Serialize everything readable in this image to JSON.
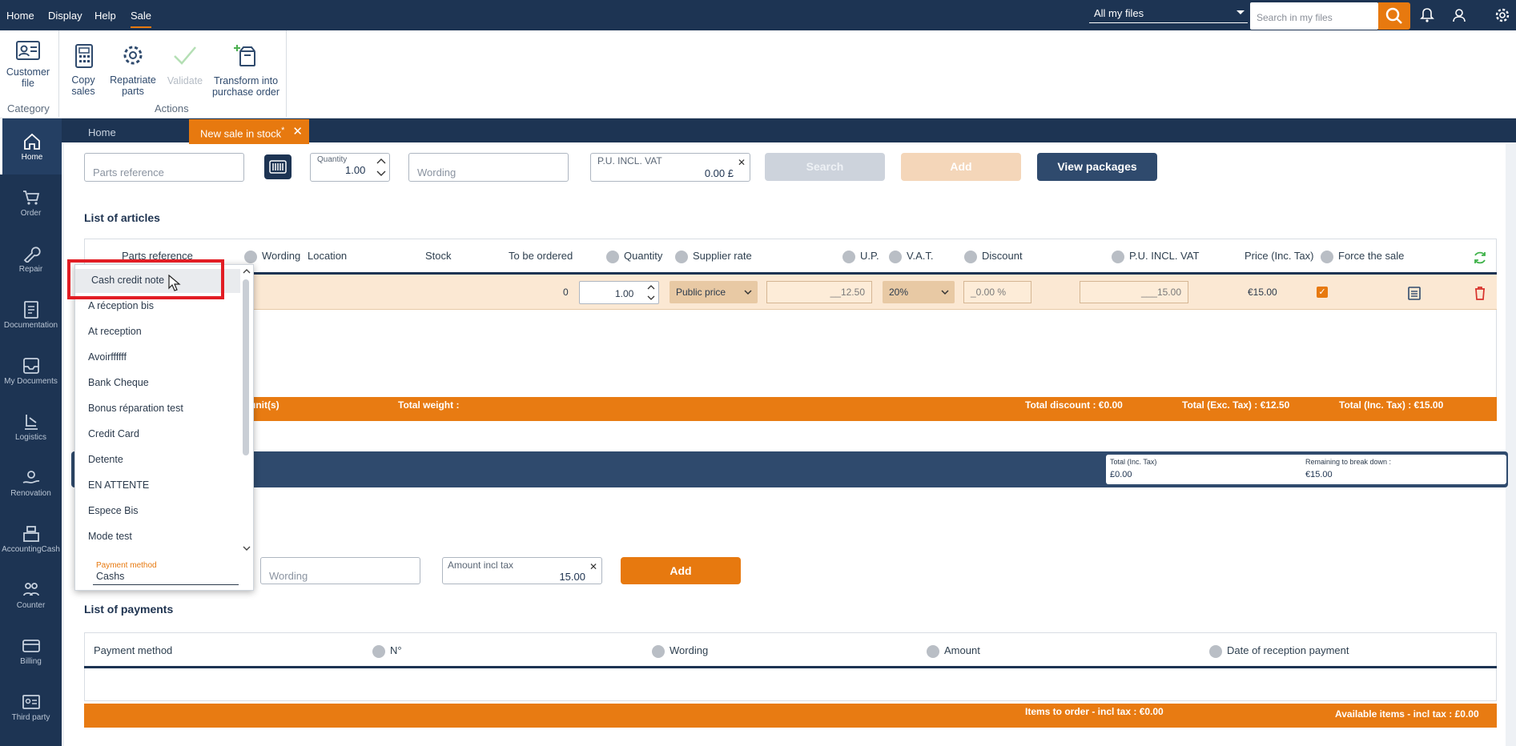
{
  "topbar": {
    "menu": [
      "Home",
      "Display",
      "Help",
      "Sale"
    ],
    "files_select": "All my files",
    "search_placeholder": "Search in my files"
  },
  "ribbon": {
    "customer_file": "Customer file",
    "category_label": "Category",
    "copy_sales": "Copy sales",
    "repatriate_parts": "Repatriate parts",
    "validate": "Validate",
    "transform": "Transform into purchase order",
    "actions_label": "Actions"
  },
  "nav": [
    "Home",
    "Order",
    "Repair",
    "Documentation",
    "My Documents",
    "Logistics",
    "Renovation",
    "AccountingCash",
    "Counter",
    "Billing",
    "Third party"
  ],
  "tabs": {
    "home": "Home",
    "new_sale": "New sale in stock",
    "modified_mark": "*"
  },
  "search_form": {
    "parts_reference_placeholder": "Parts reference",
    "quantity_label": "Quantity",
    "quantity_value": "1.00",
    "wording_placeholder": "Wording",
    "pu_label": "P.U. INCL. VAT",
    "pu_value": "0.00 £",
    "search_btn": "Search",
    "add_btn": "Add",
    "view_packages_btn": "View packages"
  },
  "articles": {
    "title": "List of articles",
    "headers": [
      "Parts reference",
      "Wording",
      "Location",
      "Stock",
      "To be ordered",
      "Quantity",
      "Supplier rate",
      "U.P.",
      "V.A.T.",
      "Discount",
      "P.U. INCL. VAT",
      "Price (Inc. Tax)",
      "Force the sale"
    ],
    "row": {
      "to_be_ordered": "0",
      "quantity": "1.00",
      "supplier_rate": "Public price",
      "up": "__12.50",
      "vat": "20%",
      "discount": "_0.00 %",
      "pu_incl": "___15.00",
      "price": "€15.00"
    },
    "footer": {
      "units": "unit(s)",
      "total_weight": "Total weight :",
      "total_discount": "Total discount : €0.00",
      "total_exc": "Total (Exc. Tax) : €12.50",
      "total_inc": "Total (Inc. Tax) : €15.00"
    }
  },
  "summary": {
    "total_label": "Total (Inc. Tax)",
    "total_value": "£0.00",
    "remaining_label": "Remaining to break down :",
    "remaining_value": "€15.00"
  },
  "payment_form": {
    "method_label": "Payment method",
    "method_value": "Cashs",
    "wording_placeholder": "Wording",
    "amount_label": "Amount incl tax",
    "amount_value": "15.00",
    "add_btn": "Add"
  },
  "payments": {
    "title": "List of payments",
    "headers": [
      "Payment method",
      "N°",
      "Wording",
      "Amount",
      "Date of reception payment"
    ],
    "footer_left": "Items to order - incl tax : €0.00",
    "footer_right": "Available items - incl tax : £0.00"
  },
  "dropdown": {
    "items": [
      "Cash credit note",
      "A réception bis",
      "At reception",
      "Avoirffffff",
      "Bank Cheque",
      "Bonus réparation test",
      "Credit Card",
      "Detente",
      "EN ATTENTE",
      "Espece Bis",
      "Mode test"
    ]
  },
  "colors": {
    "navy": "#1d3453",
    "orange": "#e7790f",
    "highlight": "#e21d24"
  }
}
